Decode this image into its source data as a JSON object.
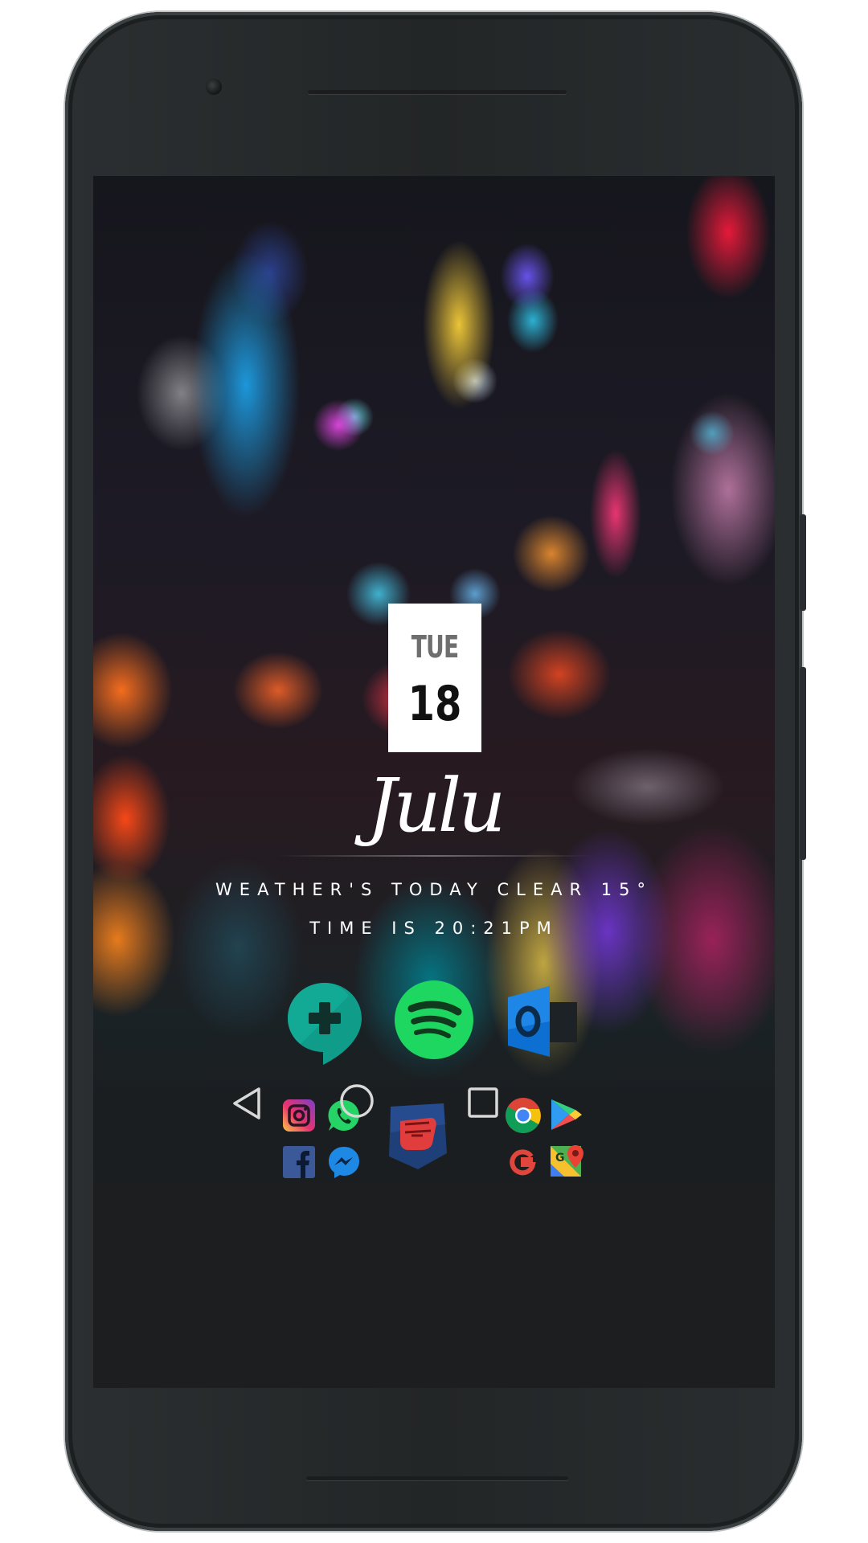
{
  "widget": {
    "day_of_week": "TUE",
    "day_number": "18",
    "brand": "Julu",
    "weather_line": "WEATHER'S TODAY CLEAR 15°",
    "time_line": "TIME IS 20:21PM"
  },
  "dock_large": [
    {
      "name": "Hangouts",
      "icon": "hangouts-icon",
      "color": "#0f9d8a"
    },
    {
      "name": "Spotify",
      "icon": "spotify-icon",
      "color": "#1ed760"
    },
    {
      "name": "Outlook",
      "icon": "outlook-icon",
      "color": "#0078d4"
    }
  ],
  "folder_left": [
    {
      "name": "Instagram",
      "icon": "instagram-icon"
    },
    {
      "name": "WhatsApp",
      "icon": "whatsapp-icon"
    },
    {
      "name": "Facebook",
      "icon": "facebook-icon"
    },
    {
      "name": "Messenger",
      "icon": "messenger-icon"
    }
  ],
  "center_app": {
    "name": "Pocket Fist",
    "icon": "fist-icon"
  },
  "folder_right": [
    {
      "name": "Chrome",
      "icon": "chrome-icon"
    },
    {
      "name": "Play Store",
      "icon": "play-store-icon"
    },
    {
      "name": "Google",
      "icon": "google-icon"
    },
    {
      "name": "Maps",
      "icon": "maps-icon"
    }
  ],
  "navbar": {
    "back": "back-icon",
    "home": "home-icon",
    "recents": "recents-icon"
  }
}
